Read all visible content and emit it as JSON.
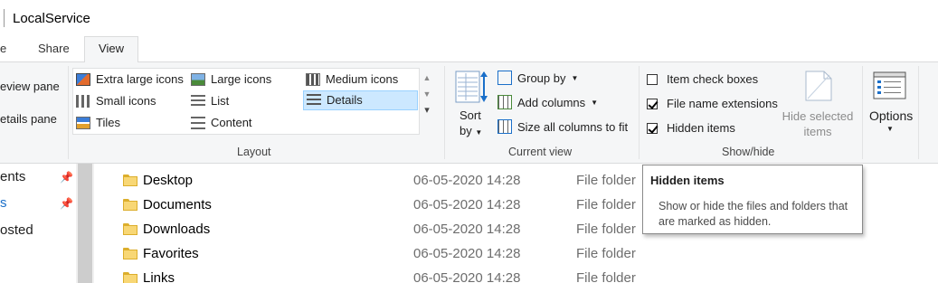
{
  "window": {
    "title": "LocalService"
  },
  "tabs": [
    {
      "label": "e"
    },
    {
      "label": "Share"
    },
    {
      "label": "View"
    }
  ],
  "panes": {
    "preview_label": "eview pane",
    "details_label": "etails pane"
  },
  "layout": {
    "group_label": "Layout",
    "items": [
      {
        "label": "Extra large icons"
      },
      {
        "label": "Large icons"
      },
      {
        "label": "Medium icons"
      },
      {
        "label": "Small icons"
      },
      {
        "label": "List"
      },
      {
        "label": "Details",
        "selected": true
      },
      {
        "label": "Tiles"
      },
      {
        "label": "Content"
      }
    ]
  },
  "current_view": {
    "group_label": "Current view",
    "sort_label": "Sort",
    "sort_by_label": "by",
    "group_by_label": "Group by",
    "add_columns_label": "Add columns",
    "size_columns_label": "Size all columns to fit"
  },
  "show_hide": {
    "group_label": "Show/hide",
    "item_check_boxes": {
      "label": "Item check boxes",
      "checked": false
    },
    "file_name_extensions": {
      "label": "File name extensions",
      "checked": true
    },
    "hidden_items": {
      "label": "Hidden items",
      "checked": true
    },
    "hide_selected_line1": "Hide selected",
    "hide_selected_line2": "items"
  },
  "options": {
    "label": "Options"
  },
  "nav": {
    "items": [
      {
        "label": "ents",
        "pinned": true
      },
      {
        "label": "s",
        "pinned": true
      },
      {
        "label": "osted",
        "pinned": false
      }
    ]
  },
  "files": [
    {
      "name": "Desktop",
      "date": "06-05-2020 14:28",
      "type": "File folder"
    },
    {
      "name": "Documents",
      "date": "06-05-2020 14:28",
      "type": "File folder"
    },
    {
      "name": "Downloads",
      "date": "06-05-2020 14:28",
      "type": "File folder"
    },
    {
      "name": "Favorites",
      "date": "06-05-2020 14:28",
      "type": "File folder"
    },
    {
      "name": "Links",
      "date": "06-05-2020 14:28",
      "type": "File folder"
    }
  ],
  "tooltip": {
    "title": "Hidden items",
    "body": "Show or hide the files and folders that are marked as hidden."
  },
  "colors": {
    "ribbon_bg": "#f5f6f7",
    "selection_bg": "#cce8ff",
    "folder_yellow": "#f8d775"
  }
}
